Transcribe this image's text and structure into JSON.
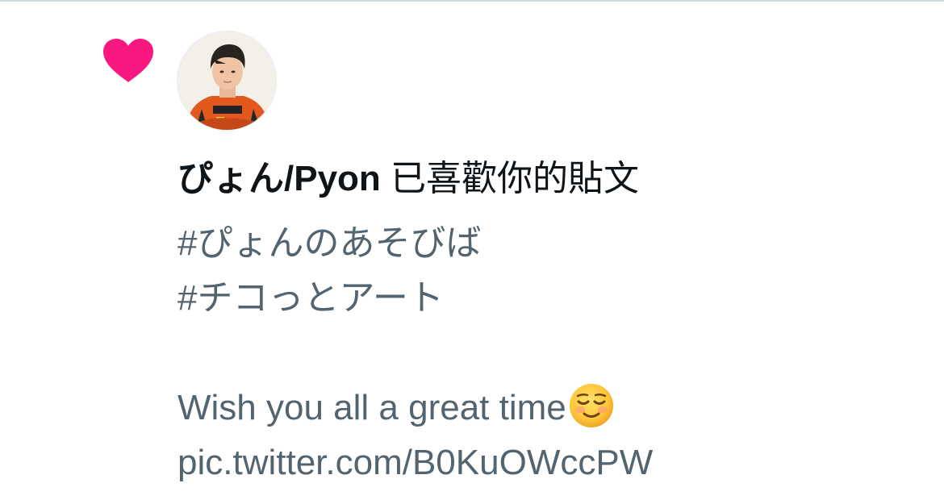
{
  "notification": {
    "type_icon": "heart-icon",
    "accent_color": "#f91880",
    "user": {
      "display_name": "ぴょん/Pyon",
      "avatar_icon": "avatar-photo"
    },
    "action_text": " 已喜歡你的貼文",
    "tweet_lines": [
      "#ぴょんのあそびば",
      "#チコっとアート",
      "",
      "Wish you all a great time",
      "pic.twitter.com/B0KuOWccPW"
    ],
    "emoji_icon": "smiling-face-icon"
  },
  "colors": {
    "primary_text": "#0f1419",
    "secondary_text": "#536471",
    "divider": "#cfd9de"
  }
}
